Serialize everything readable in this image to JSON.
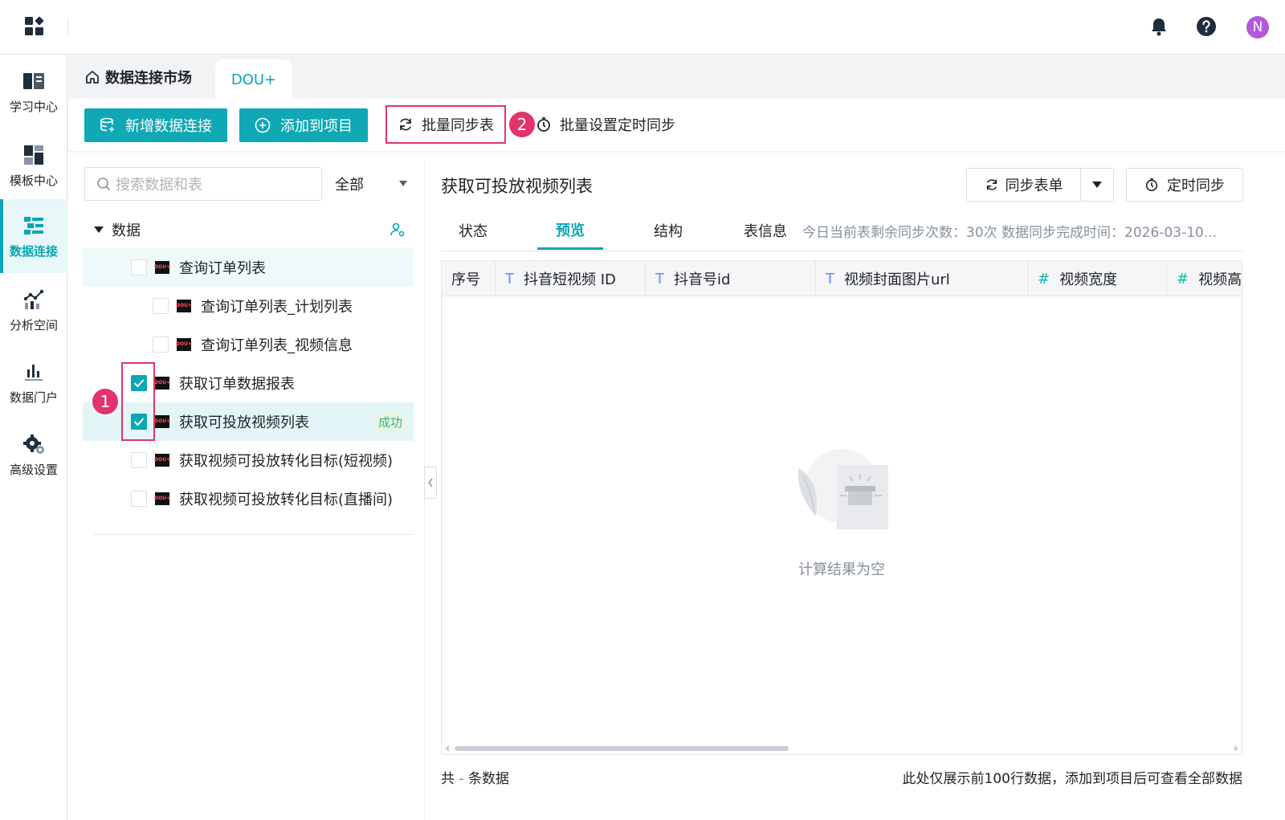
{
  "colors": {
    "accent": "#0aa6b5",
    "annotation": "#e2336b",
    "avatar": "#b35ad9",
    "success": "#3cb371"
  },
  "topbar": {
    "avatar_letter": "N",
    "icons": [
      "apps-icon",
      "bell-icon",
      "help-icon"
    ]
  },
  "sidenav": {
    "items": [
      {
        "label": "学习中心",
        "icon": "book-icon",
        "active": false
      },
      {
        "label": "模板中心",
        "icon": "template-icon",
        "active": false
      },
      {
        "label": "数据连接",
        "icon": "data-connect-icon",
        "active": true
      },
      {
        "label": "分析空间",
        "icon": "analysis-icon",
        "active": false
      },
      {
        "label": "数据门户",
        "icon": "portal-icon",
        "active": false
      },
      {
        "label": "高级设置",
        "icon": "settings-gear-icon",
        "active": false
      }
    ]
  },
  "tabs": {
    "home_label": "数据连接市场",
    "active_tab": "DOU+"
  },
  "toolbar": {
    "new_connection": "新增数据连接",
    "add_to_project": "添加到项目",
    "batch_sync": "批量同步表",
    "batch_schedule": "批量设置定时同步",
    "annotation_2": "2"
  },
  "left": {
    "search_placeholder": "搜索数据和表",
    "scope": "全部",
    "group_label": "数据",
    "annotation_1": "1",
    "tree": [
      {
        "label": "查询订单列表",
        "checked": false,
        "level": 0,
        "status": ""
      },
      {
        "label": "查询订单列表_计划列表",
        "checked": false,
        "level": 1,
        "status": ""
      },
      {
        "label": "查询订单列表_视频信息",
        "checked": false,
        "level": 1,
        "status": ""
      },
      {
        "label": "获取订单数据报表",
        "checked": true,
        "level": 0,
        "status": ""
      },
      {
        "label": "获取可投放视频列表",
        "checked": true,
        "level": 0,
        "status": "成功"
      },
      {
        "label": "获取视频可投放转化目标(短视频)",
        "checked": false,
        "level": 0,
        "status": ""
      },
      {
        "label": "获取视频可投放转化目标(直播间)",
        "checked": false,
        "level": 0,
        "status": ""
      }
    ],
    "logo_text": "DOU+"
  },
  "right": {
    "title": "获取可投放视频列表",
    "sync_button": "同步表单",
    "timer_button": "定时同步",
    "subtabs": [
      "状态",
      "预览",
      "结构"
    ],
    "active_subtab": "预览",
    "info_label": "表信息",
    "info_text": "今日当前表剩余同步次数：30次   数据同步完成时间：2026-03-10...",
    "columns": [
      {
        "label": "序号",
        "type": ""
      },
      {
        "label": "抖音短视频 ID",
        "type": "T"
      },
      {
        "label": "抖音号id",
        "type": "T"
      },
      {
        "label": "视频封面图片url",
        "type": "T"
      },
      {
        "label": "视频宽度",
        "type": "#"
      },
      {
        "label": "视频高",
        "type": "#"
      }
    ],
    "empty_text": "计算结果为空",
    "footer_prefix": "共",
    "footer_count": "-",
    "footer_suffix": "条数据",
    "footer_note": "此处仅展示前100行数据，添加到项目后可查看全部数据"
  }
}
